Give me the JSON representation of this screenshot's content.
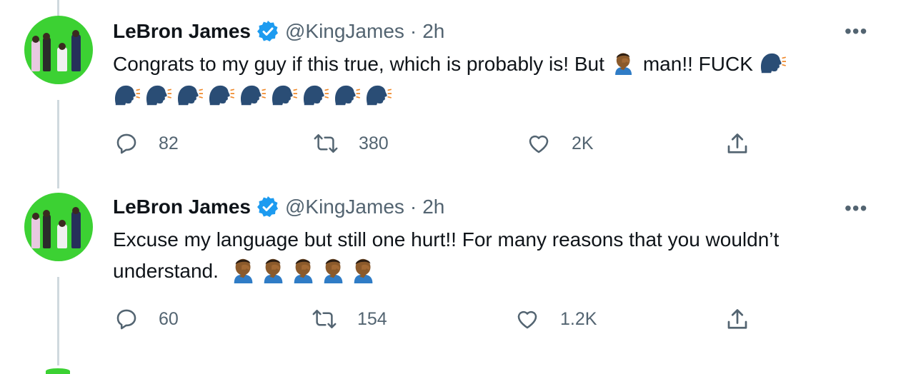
{
  "tweets": [
    {
      "name": "LeBron James",
      "handle": "@KingJames",
      "separator": "·",
      "time": "2h",
      "more": "•••",
      "text_part1": "Congrats to my guy if this true, which is probably is! But",
      "text_part2": "man!! FUCK",
      "emoji_inline": [
        "facepalm-emoji",
        "speaking-head-emoji"
      ],
      "emoji_line_count": 9,
      "emoji_line": "speaking-head-emoji",
      "actions": {
        "reply": "82",
        "retweet": "380",
        "like": "2K"
      }
    },
    {
      "name": "LeBron James",
      "handle": "@KingJames",
      "separator": "·",
      "time": "2h",
      "more": "•••",
      "text_line1": "Excuse my language but still one hurt!! For many reasons that you wouldn’t",
      "text_line2": "understand.",
      "emoji_line_count": 5,
      "emoji_line": "facepalm-emoji",
      "actions": {
        "reply": "60",
        "retweet": "154",
        "like": "1.2K"
      }
    }
  ],
  "colors": {
    "avatar_bg": "#3cd133",
    "verified": "#1d9bf0",
    "muted": "#536471",
    "thread_line": "#cfd9de"
  }
}
